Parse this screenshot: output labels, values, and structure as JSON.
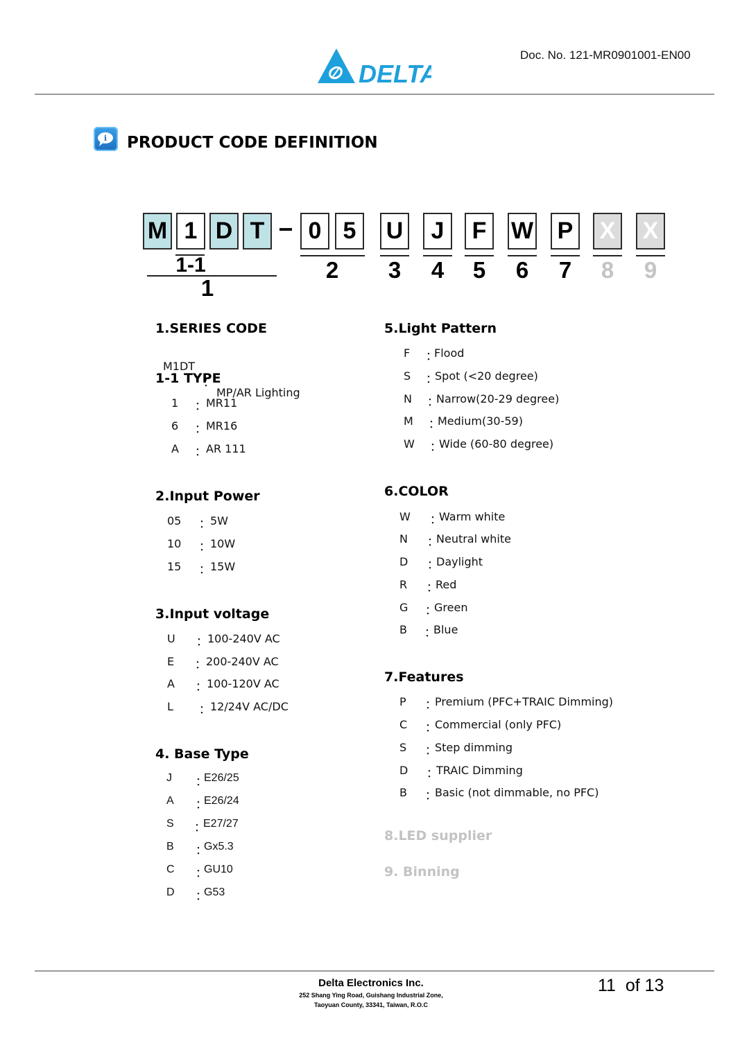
{
  "header": {
    "logo_text": "DELTA",
    "doc_no": "Doc. No. 121-MR0901001-EN00"
  },
  "title": {
    "icon": "info-speech-bubble-icon",
    "text": "PRODUCT CODE DEFINITION"
  },
  "code": {
    "chars": [
      "M",
      "1",
      "D",
      "T",
      "0",
      "5",
      "U",
      "J",
      "F",
      "W",
      "P",
      "X",
      "X"
    ],
    "separator": "–",
    "position_labels": {
      "p1_1": "1-1",
      "p1": "1",
      "p2": "2",
      "p3": "3",
      "p4": "4",
      "p5": "5",
      "p6": "6",
      "p7": "7",
      "p8": "8",
      "p9": "9"
    },
    "colors": {
      "series_box": "#bfe2e6",
      "placeholder_box": "#dcdcdc",
      "placeholder_label": "#c4c4c4"
    }
  },
  "sections": {
    "series": {
      "heading": "1.SERIES CODE",
      "items": [
        {
          "code": "M1DT",
          "desc": "MP/AR Lighting"
        }
      ]
    },
    "type": {
      "heading": "1-1 TYPE",
      "items": [
        {
          "code": "1",
          "desc": "MR11"
        },
        {
          "code": "6",
          "desc": "MR16"
        },
        {
          "code": "A",
          "desc": "AR 111"
        }
      ]
    },
    "power": {
      "heading": "2.Input Power",
      "items": [
        {
          "code": "05",
          "desc": "5W"
        },
        {
          "code": "10",
          "desc": "10W"
        },
        {
          "code": "15",
          "desc": "15W"
        }
      ]
    },
    "voltage": {
      "heading": "3.Input voltage",
      "items": [
        {
          "code": "U",
          "desc": "100-240V AC"
        },
        {
          "code": "E",
          "desc": "200-240V AC"
        },
        {
          "code": "A",
          "desc": "100-120V AC"
        },
        {
          "code": "L",
          "desc": "12/24V AC/DC"
        }
      ]
    },
    "base": {
      "heading": "4. Base Type",
      "items": [
        {
          "code": "J",
          "desc": "E26/25"
        },
        {
          "code": "A",
          "desc": "E26/24"
        },
        {
          "code": "S",
          "desc": "E27/27"
        },
        {
          "code": "B",
          "desc": "Gx5.3"
        },
        {
          "code": "C",
          "desc": "GU10"
        },
        {
          "code": "D",
          "desc": "G53"
        }
      ]
    },
    "pattern": {
      "heading": "5.Light Pattern",
      "items": [
        {
          "code": "F",
          "desc": "Flood"
        },
        {
          "code": "S",
          "desc": "Spot (<20 degree)"
        },
        {
          "code": "N",
          "desc": "Narrow(20-29 degree)"
        },
        {
          "code": "M",
          "desc": "Medium(30-59)"
        },
        {
          "code": "W",
          "desc": "Wide (60-80 degree)"
        }
      ]
    },
    "color": {
      "heading": "6.COLOR",
      "items": [
        {
          "code": "W",
          "desc": "Warm white"
        },
        {
          "code": "N",
          "desc": "Neutral white"
        },
        {
          "code": "D",
          "desc": "Daylight"
        },
        {
          "code": "R",
          "desc": "Red"
        },
        {
          "code": "G",
          "desc": "Green"
        },
        {
          "code": "B",
          "desc": "Blue"
        }
      ]
    },
    "features": {
      "heading": "7.Features",
      "items": [
        {
          "code": "P",
          "desc": "Premium (PFC+TRAIC Dimming)"
        },
        {
          "code": "C",
          "desc": "Commercial (only PFC)"
        },
        {
          "code": "S",
          "desc": "Step dimming"
        },
        {
          "code": "D",
          "desc": "TRAIC Dimming"
        },
        {
          "code": "B",
          "desc": "Basic (not dimmable, no PFC)"
        }
      ]
    },
    "led_supplier": {
      "heading": "8.LED supplier"
    },
    "binning": {
      "heading": "9. Binning"
    }
  },
  "separator_char": "：",
  "footer": {
    "company": "Delta Electronics Inc.",
    "address_line1": "252 Shang Ying Road, Guishang Industrial Zone,",
    "address_line2": "Taoyuan County, 33341, Taiwan, R.O.C",
    "page": "11  of 13"
  },
  "brand_color": "#1ea0dc"
}
